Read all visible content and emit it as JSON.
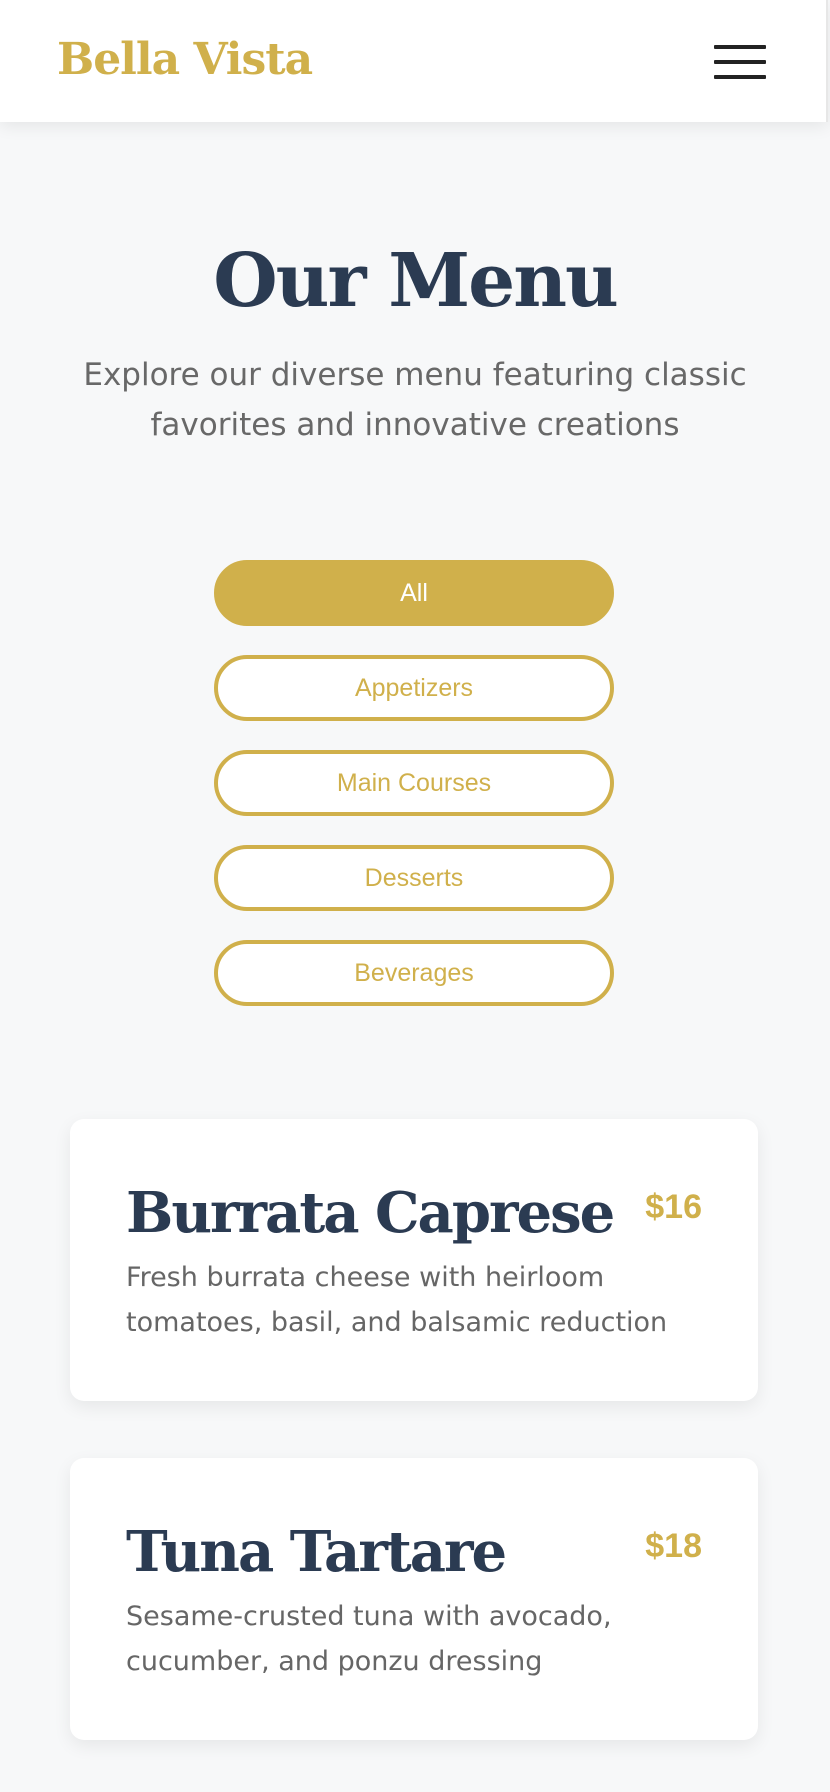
{
  "header": {
    "brand": "Bella Vista",
    "menu_icon": "hamburger-menu-icon"
  },
  "hero": {
    "title": "Our Menu",
    "subtitle": "Explore our diverse menu featuring classic favorites and innovative creations"
  },
  "filters": [
    {
      "label": "All",
      "active": true
    },
    {
      "label": "Appetizers",
      "active": false
    },
    {
      "label": "Main Courses",
      "active": false
    },
    {
      "label": "Desserts",
      "active": false
    },
    {
      "label": "Beverages",
      "active": false
    }
  ],
  "menu_items": [
    {
      "name": "Burrata Caprese",
      "price": "$16",
      "description": "Fresh burrata cheese with heirloom tomatoes, basil, and balsamic reduction"
    },
    {
      "name": "Tuna Tartare",
      "price": "$18",
      "description": "Sesame-crusted tuna with avocado, cucumber, and ponzu dressing"
    }
  ],
  "colors": {
    "accent": "#d0b04b",
    "heading": "#2b3b52",
    "text": "#686868",
    "background": "#f7f8f9"
  }
}
